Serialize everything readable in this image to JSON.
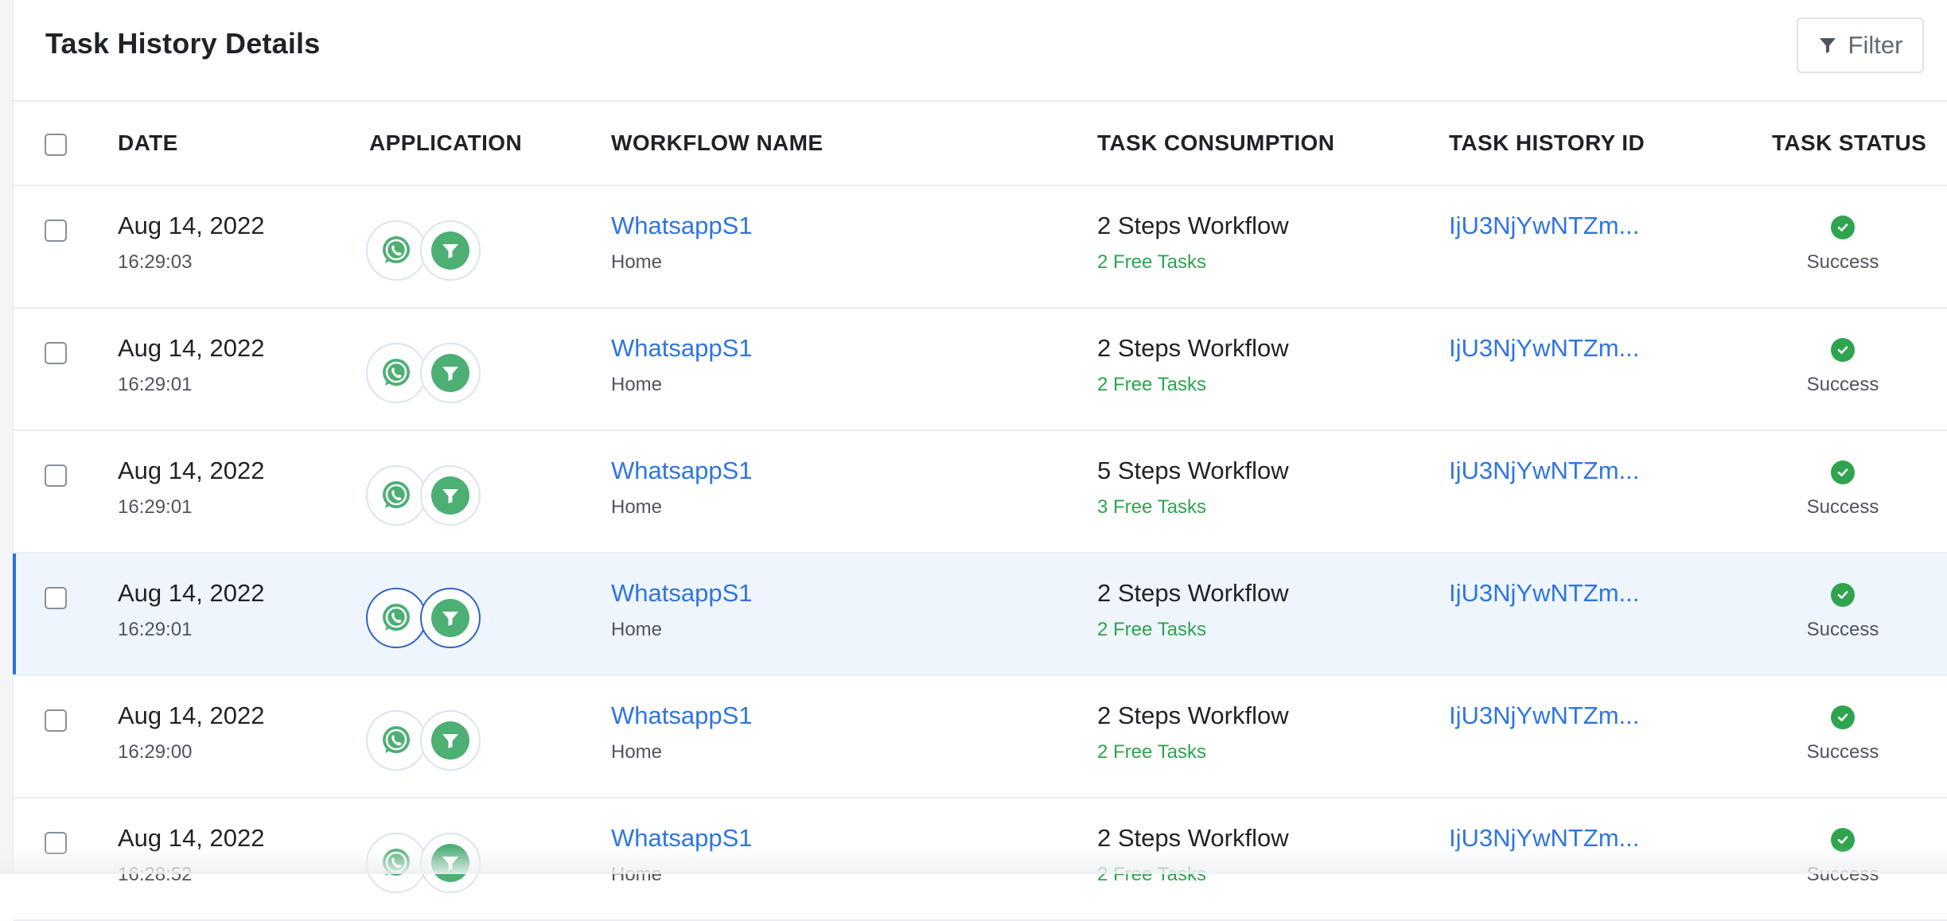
{
  "page": {
    "title": "Task History Details",
    "filter_label": "Filter"
  },
  "columns": {
    "date": "DATE",
    "application": "APPLICATION",
    "workflow_name": "WORKFLOW NAME",
    "task_consumption": "TASK CONSUMPTION",
    "task_history_id": "TASK HISTORY ID",
    "task_status": "TASK STATUS"
  },
  "rows": [
    {
      "date": "Aug 14, 2022",
      "time": "16:29:03",
      "apps": [
        "whatsapp-icon",
        "filter-icon"
      ],
      "workflow": "WhatsappS1",
      "folder": "Home",
      "consumption": "2 Steps Workflow",
      "free_tasks": "2 Free Tasks",
      "history_id": "IjU3NjYwNTZm...",
      "status": "Success",
      "selected": false
    },
    {
      "date": "Aug 14, 2022",
      "time": "16:29:01",
      "apps": [
        "whatsapp-icon",
        "filter-icon"
      ],
      "workflow": "WhatsappS1",
      "folder": "Home",
      "consumption": "2 Steps Workflow",
      "free_tasks": "2 Free Tasks",
      "history_id": "IjU3NjYwNTZm...",
      "status": "Success",
      "selected": false
    },
    {
      "date": "Aug 14, 2022",
      "time": "16:29:01",
      "apps": [
        "whatsapp-icon",
        "filter-icon"
      ],
      "workflow": "WhatsappS1",
      "folder": "Home",
      "consumption": "5 Steps Workflow",
      "free_tasks": "3 Free Tasks",
      "history_id": "IjU3NjYwNTZm...",
      "status": "Success",
      "selected": false
    },
    {
      "date": "Aug 14, 2022",
      "time": "16:29:01",
      "apps": [
        "whatsapp-icon",
        "filter-icon"
      ],
      "workflow": "WhatsappS1",
      "folder": "Home",
      "consumption": "2 Steps Workflow",
      "free_tasks": "2 Free Tasks",
      "history_id": "IjU3NjYwNTZm...",
      "status": "Success",
      "selected": true
    },
    {
      "date": "Aug 14, 2022",
      "time": "16:29:00",
      "apps": [
        "whatsapp-icon",
        "filter-icon"
      ],
      "workflow": "WhatsappS1",
      "folder": "Home",
      "consumption": "2 Steps Workflow",
      "free_tasks": "2 Free Tasks",
      "history_id": "IjU3NjYwNTZm...",
      "status": "Success",
      "selected": false
    },
    {
      "date": "Aug 14, 2022",
      "time": "16:28:52",
      "apps": [
        "whatsapp-icon",
        "filter-icon"
      ],
      "workflow": "WhatsappS1",
      "folder": "Home",
      "consumption": "2 Steps Workflow",
      "free_tasks": "2 Free Tasks",
      "history_id": "IjU3NjYwNTZm...",
      "status": "Success",
      "selected": false
    }
  ],
  "colors": {
    "link": "#2f75e0",
    "success": "#2ea44f",
    "app_green": "#4caf74",
    "selected_row": "#eef5fc"
  }
}
